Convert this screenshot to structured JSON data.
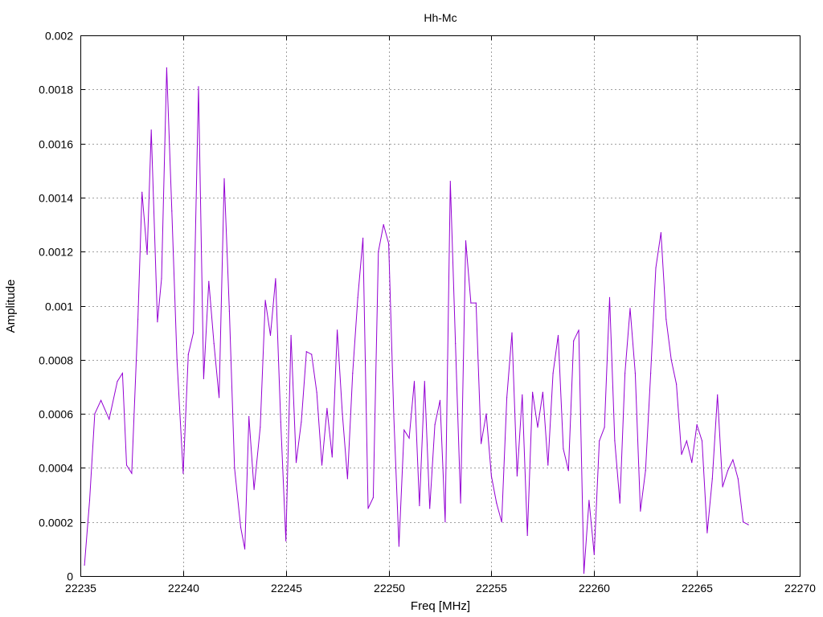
{
  "chart_data": {
    "type": "line",
    "title": "Hh-Mc",
    "xlabel": "Freq [MHz]",
    "ylabel": "Amplitude",
    "xlim": [
      22235,
      22270
    ],
    "ylim": [
      0,
      0.002
    ],
    "xticks": [
      "22235",
      "22240",
      "22245",
      "22250",
      "22255",
      "22260",
      "22265",
      "22270"
    ],
    "yticks": [
      "0",
      "0.0002",
      "0.0004",
      "0.0006",
      "0.0008",
      "0.001",
      "0.0012",
      "0.0014",
      "0.0016",
      "0.0018",
      "0.002"
    ],
    "grid": true,
    "line_color": "#9400d3",
    "series": [
      {
        "x": [
          22235.2,
          22235.45,
          22235.7,
          22236.0,
          22236.4,
          22236.8,
          22237.05,
          22237.25,
          22237.5,
          22237.8,
          22238.0,
          22238.25,
          22238.45,
          22238.75,
          22238.95,
          22239.2,
          22239.45,
          22239.7,
          22240.0,
          22240.25,
          22240.5,
          22240.75,
          22241.0,
          22241.25,
          22241.5,
          22241.75,
          22242.0,
          22242.25,
          22242.5,
          22242.8,
          22243.0,
          22243.2,
          22243.45,
          22243.75,
          22244.0,
          22244.25,
          22244.5,
          22244.75,
          22245.0,
          22245.25,
          22245.5,
          22245.75,
          22246.0,
          22246.25,
          22246.5,
          22246.75,
          22247.0,
          22247.25,
          22247.5,
          22247.75,
          22248.0,
          22248.25,
          22248.5,
          22248.75,
          22249.0,
          22249.25,
          22249.5,
          22249.75,
          22250.0,
          22250.25,
          22250.5,
          22250.75,
          22251.0,
          22251.25,
          22251.5,
          22251.75,
          22252.0,
          22252.25,
          22252.5,
          22252.75,
          22253.0,
          22253.25,
          22253.5,
          22253.75,
          22254.0,
          22254.25,
          22254.5,
          22254.75,
          22255.0,
          22255.25,
          22255.5,
          22255.75,
          22256.0,
          22256.25,
          22256.5,
          22256.75,
          22257.0,
          22257.25,
          22257.5,
          22257.75,
          22258.0,
          22258.25,
          22258.5,
          22258.75,
          22259.0,
          22259.25,
          22259.5,
          22259.75,
          22260.0,
          22260.25,
          22260.5,
          22260.75,
          22261.0,
          22261.25,
          22261.5,
          22261.75,
          22262.0,
          22262.25,
          22262.5,
          22262.75,
          22263.0,
          22263.25,
          22263.5,
          22263.75,
          22264.0,
          22264.25,
          22264.5,
          22264.75,
          22265.0,
          22265.25,
          22265.5,
          22265.75,
          22266.0,
          22266.25,
          22266.5,
          22266.75,
          22267.0,
          22267.25,
          22267.5
        ],
        "y": [
          4e-05,
          0.00028,
          0.0006,
          0.00065,
          0.00058,
          0.00072,
          0.00075,
          0.00041,
          0.00038,
          0.00095,
          0.00142,
          0.00119,
          0.00165,
          0.00094,
          0.0011,
          0.00188,
          0.00135,
          0.0008,
          0.00038,
          0.00082,
          0.0009,
          0.00181,
          0.00073,
          0.00109,
          0.00086,
          0.00066,
          0.00147,
          0.00098,
          0.0004,
          0.00018,
          0.0001,
          0.00059,
          0.00032,
          0.00055,
          0.00102,
          0.00089,
          0.0011,
          0.00057,
          0.00013,
          0.00089,
          0.00042,
          0.00057,
          0.00083,
          0.00082,
          0.00068,
          0.00041,
          0.00062,
          0.00044,
          0.00091,
          0.0006,
          0.00036,
          0.00075,
          0.00103,
          0.00125,
          0.00025,
          0.00029,
          0.0012,
          0.0013,
          0.00123,
          0.00059,
          0.00011,
          0.00054,
          0.00051,
          0.00072,
          0.00026,
          0.00072,
          0.00025,
          0.00056,
          0.00065,
          0.0002,
          0.00146,
          0.00086,
          0.00027,
          0.00124,
          0.00101,
          0.00101,
          0.00049,
          0.0006,
          0.00037,
          0.00027,
          0.0002,
          0.00066,
          0.0009,
          0.00037,
          0.00067,
          0.00015,
          0.00068,
          0.00055,
          0.00068,
          0.00041,
          0.00075,
          0.00089,
          0.00047,
          0.00039,
          0.00087,
          0.00091,
          1e-05,
          0.00028,
          8e-05,
          0.0005,
          0.00055,
          0.00103,
          0.0005,
          0.00027,
          0.00075,
          0.00099,
          0.00075,
          0.00024,
          0.00039,
          0.00075,
          0.00114,
          0.00127,
          0.00095,
          0.0008,
          0.00071,
          0.00045,
          0.0005,
          0.00042,
          0.00056,
          0.0005,
          0.00016,
          0.00036,
          0.00067,
          0.00033,
          0.00039,
          0.00043,
          0.00036,
          0.0002,
          0.00019
        ]
      }
    ]
  }
}
